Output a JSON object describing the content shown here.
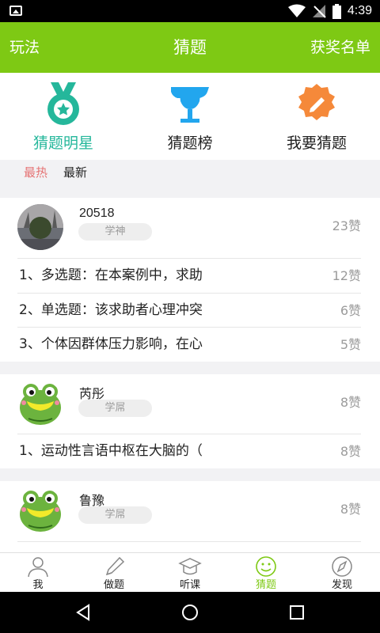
{
  "status_bar": {
    "time": "4:39"
  },
  "topbar": {
    "left": "玩法",
    "title": "猜题",
    "right": "获奖名单"
  },
  "categories": [
    {
      "label": "猜题明星",
      "icon": "medal-icon",
      "color": "#25b79b"
    },
    {
      "label": "猜题榜",
      "icon": "trophy-icon",
      "color": "#22a6ee"
    },
    {
      "label": "我要猜题",
      "icon": "pencil-badge-icon",
      "color": "#f5893a"
    }
  ],
  "filter": {
    "hot": "最热",
    "new": "最新"
  },
  "feed": {
    "user1": {
      "name": "20518",
      "badge": "学神",
      "likes": "23赞",
      "questions": [
        {
          "text": "1、多选题：在本案例中，求助",
          "likes": "12赞"
        },
        {
          "text": "2、单选题：该求助者心理冲突",
          "likes": "6赞"
        },
        {
          "text": "3、个体因群体压力影响，在心",
          "likes": "5赞"
        }
      ]
    },
    "user2": {
      "name": "芮彤",
      "badge": "学屌",
      "likes": "8赞",
      "questions": [
        {
          "text": "1、运动性言语中枢在大脑的（",
          "likes": "8赞"
        }
      ]
    },
    "user3": {
      "name": "鲁豫",
      "badge": "学屌",
      "likes": "8赞"
    }
  },
  "bottom_nav": [
    {
      "label": "我",
      "icon": "person-icon"
    },
    {
      "label": "做题",
      "icon": "pen-icon"
    },
    {
      "label": "听课",
      "icon": "graduation-cap-icon"
    },
    {
      "label": "猜题",
      "icon": "smile-icon",
      "active": true
    },
    {
      "label": "发现",
      "icon": "compass-icon"
    }
  ],
  "colors": {
    "accent_green": "#7ec914",
    "teal": "#25b79b",
    "hot_red": "#e57373",
    "muted": "#9b9b9b"
  }
}
